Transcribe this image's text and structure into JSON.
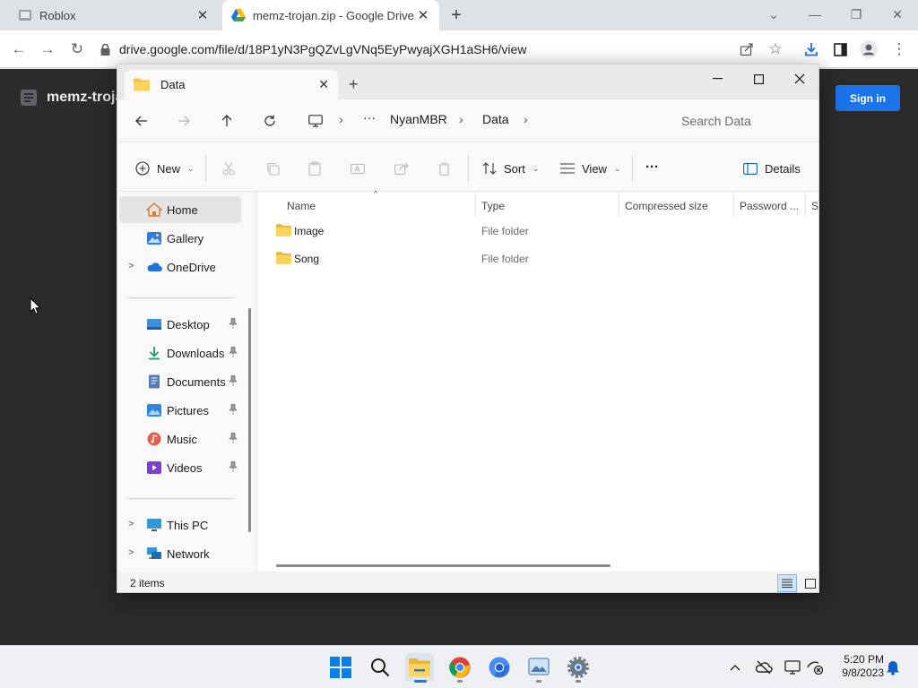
{
  "chrome": {
    "tabs": [
      {
        "title": "Roblox"
      },
      {
        "title": "memz-trojan.zip - Google Drive"
      }
    ],
    "url": "drive.google.com/file/d/18P1yN3PgQZvLgVNq5EyPwyajXGH1aSH6/view"
  },
  "drive": {
    "file_title": "memz-trojan.zip",
    "sign_in_label": "Sign in"
  },
  "explorer": {
    "tab_title": "Data",
    "breadcrumb": {
      "ellipsis": "···",
      "items": [
        "NyanMBR",
        "Data"
      ]
    },
    "search_placeholder": "Search Data",
    "commands": {
      "new": "New",
      "sort": "Sort",
      "view": "View",
      "more": "···",
      "details": "Details"
    },
    "nav": {
      "home": "Home",
      "gallery": "Gallery",
      "onedrive": "OneDrive",
      "desktop": "Desktop",
      "downloads": "Downloads",
      "documents": "Documents",
      "pictures": "Pictures",
      "music": "Music",
      "videos": "Videos",
      "thispc": "This PC",
      "network": "Network"
    },
    "columns": {
      "name": "Name",
      "type": "Type",
      "compressed": "Compressed size",
      "password": "Password ...",
      "size": "Si"
    },
    "rows": [
      {
        "name": "Image",
        "type": "File folder"
      },
      {
        "name": "Song",
        "type": "File folder"
      }
    ],
    "status": "2 items"
  },
  "taskbar": {
    "time": "5:20 PM",
    "date": "9/8/2023"
  },
  "colors": {
    "accent": "#1a73e8",
    "folder": "#f6c343",
    "page_bg": "#2b2b2b"
  }
}
